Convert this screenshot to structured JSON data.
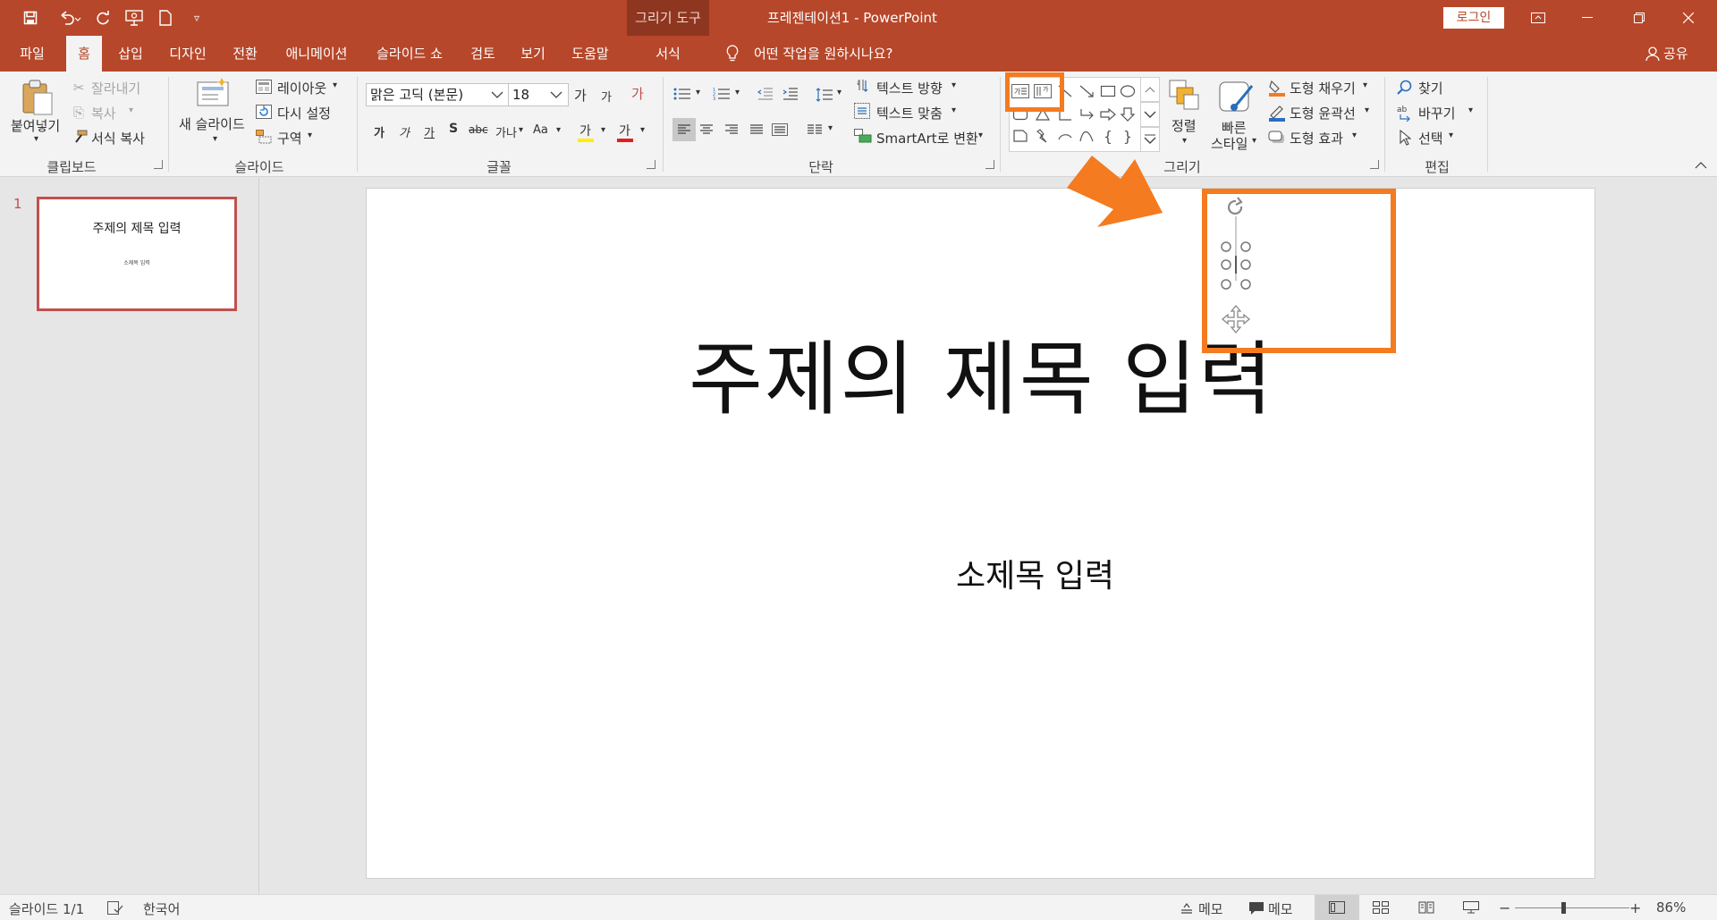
{
  "titlebar": {
    "context_group": "그리기 도구",
    "window_title": "프레젠테이션1  -  PowerPoint",
    "login": "로그인"
  },
  "quick_access": [
    "save-icon",
    "undo-icon",
    "redo-icon",
    "slideshow-icon",
    "new-icon",
    "customize-icon"
  ],
  "tabs": [
    {
      "label": "파일"
    },
    {
      "label": "홈"
    },
    {
      "label": "삽입"
    },
    {
      "label": "디자인"
    },
    {
      "label": "전환"
    },
    {
      "label": "애니메이션"
    },
    {
      "label": "슬라이드 쇼"
    },
    {
      "label": "검토"
    },
    {
      "label": "보기"
    },
    {
      "label": "도움말"
    },
    {
      "label": "서식"
    }
  ],
  "tell_me": "어떤 작업을 원하시나요?",
  "share": "공유",
  "ribbon": {
    "clipboard": {
      "group": "클립보드",
      "paste": "붙여넣기",
      "cut": "잘라내기",
      "copy": "복사",
      "format_painter": "서식 복사"
    },
    "slides": {
      "group": "슬라이드",
      "new_slide": "새 슬라이드",
      "layout": "레이아웃",
      "reset": "다시 설정",
      "section": "구역"
    },
    "font": {
      "group": "글꼴",
      "font_name": "맑은 고딕 (본문)",
      "font_size": "18",
      "grow": "가",
      "shrink": "가",
      "clear": "가",
      "bold": "가",
      "italic": "가",
      "underline": "가",
      "shadow": "S",
      "strike": "abc",
      "spacing": "가나",
      "case": "Aa",
      "highlight": "가",
      "color": "가"
    },
    "paragraph": {
      "group": "단락",
      "text_direction": "텍스트 방향",
      "align_text": "텍스트 맞춤",
      "smartart": "SmartArt로 변환"
    },
    "drawing": {
      "group": "그리기",
      "arrange": "정렬",
      "quick_styles_1": "빠른",
      "quick_styles_2": "스타일",
      "fill": "도형 채우기",
      "outline": "도형 윤곽선",
      "effects": "도형 효과",
      "horizontal_textbox_glyph": "가",
      "vertical_textbox_glyph": "가"
    },
    "editing": {
      "group": "편집",
      "find": "찾기",
      "replace": "바꾸기",
      "select": "선택"
    }
  },
  "thumbnail": {
    "number": "1",
    "title": "주제의 제목 입력",
    "subtitle": "소제목 입력"
  },
  "slide": {
    "title": "주제의 제목 입력",
    "subtitle": "소제목 입력"
  },
  "status": {
    "slide_count": "슬라이드 1/1",
    "language": "한국어",
    "notes": "메모",
    "comments": "메모",
    "zoom": "86%",
    "zoom_fraction": 0.86
  },
  "colors": {
    "brand": "#b7472a",
    "highlight_orange": "#f47b20",
    "ribbon_bg": "#f3f3f3"
  }
}
